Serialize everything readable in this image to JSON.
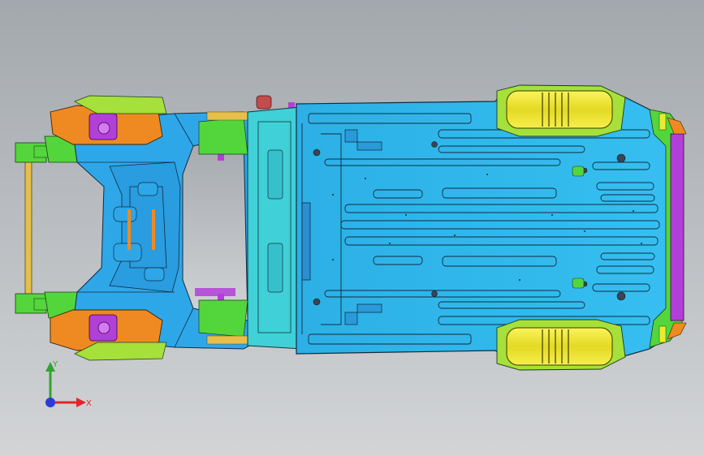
{
  "viewport": {
    "background_top": "#a3a8ad",
    "background_bottom": "#d2d4d6"
  },
  "triad": {
    "x_label": "X",
    "y_label": "Y",
    "x_color": "#e4242a",
    "y_color": "#2fa52f",
    "z_color": "#2d3ad8"
  },
  "colors": {
    "floor_pan": "#2eb8ea",
    "front_frame": "#2ea7e8",
    "cross_members": "#3fd0d8",
    "front_rail": "#53d63b",
    "strut_towers": "#ef8a22",
    "brackets": "#b33fd9",
    "wheel_wells": "#e9ea33",
    "rear_wheel_house": "#a6e03a",
    "bumper_beam": "#e6bf4a",
    "edge_lines": "#1b2a3a"
  },
  "icons": {
    "model": "car-body-in-white-underbody",
    "triad": "coordinate-axes-icon"
  }
}
